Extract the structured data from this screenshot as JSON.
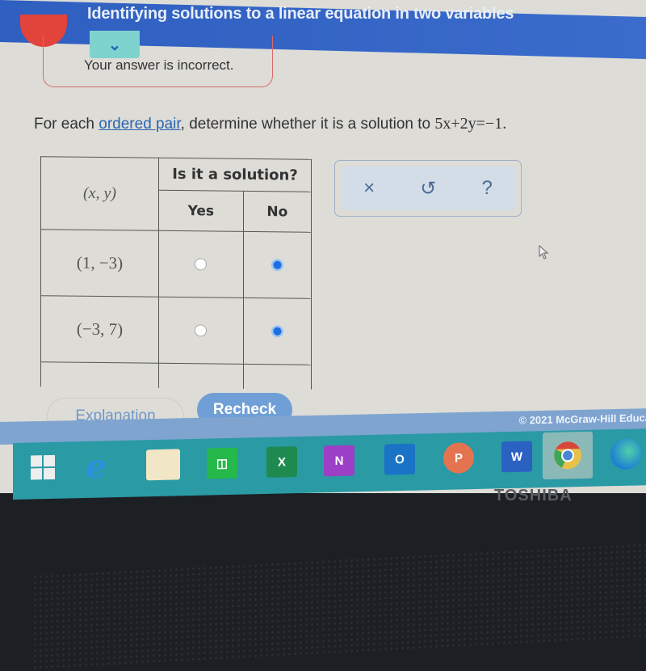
{
  "header": {
    "title": "Identifying solutions to a linear equation in two variables"
  },
  "feedback": {
    "message": "Your answer is incorrect.",
    "expand_icon": "chevron-down-icon"
  },
  "prompt": {
    "before": "For each ",
    "link": "ordered pair",
    "after": ", determine whether it is a solution to ",
    "equation": "5x+2y=−1."
  },
  "table": {
    "header_group": "Is it a solution?",
    "col_pair": "(x, y)",
    "col_yes": "Yes",
    "col_no": "No",
    "rows": [
      {
        "pair": "(1, −3)",
        "selected": "No"
      },
      {
        "pair": "(−3, 7)",
        "selected": "No"
      }
    ]
  },
  "tools": {
    "clear": "×",
    "undo": "↺",
    "help": "?"
  },
  "actions": {
    "explanation": "Explanation",
    "recheck": "Recheck"
  },
  "footer": {
    "copyright": "© 2021 McGraw-Hill Educa"
  },
  "taskbar": {
    "apps": [
      {
        "name": "windows-start",
        "label": ""
      },
      {
        "name": "internet-explorer",
        "label": "e"
      },
      {
        "name": "file-explorer",
        "label": ""
      },
      {
        "name": "microsoft-store",
        "label": ""
      },
      {
        "name": "excel",
        "label": "X"
      },
      {
        "name": "onenote",
        "label": "N"
      },
      {
        "name": "outlook",
        "label": "O"
      },
      {
        "name": "powerpoint",
        "label": "P"
      },
      {
        "name": "word",
        "label": "W"
      },
      {
        "name": "chrome",
        "label": ""
      },
      {
        "name": "edge",
        "label": ""
      }
    ]
  },
  "device": {
    "brand": "TOSHIBA"
  },
  "colors": {
    "header": "#3366c6",
    "accent": "#1f6fe0",
    "error": "#e2433b",
    "taskbar": "#2a9aa4"
  }
}
